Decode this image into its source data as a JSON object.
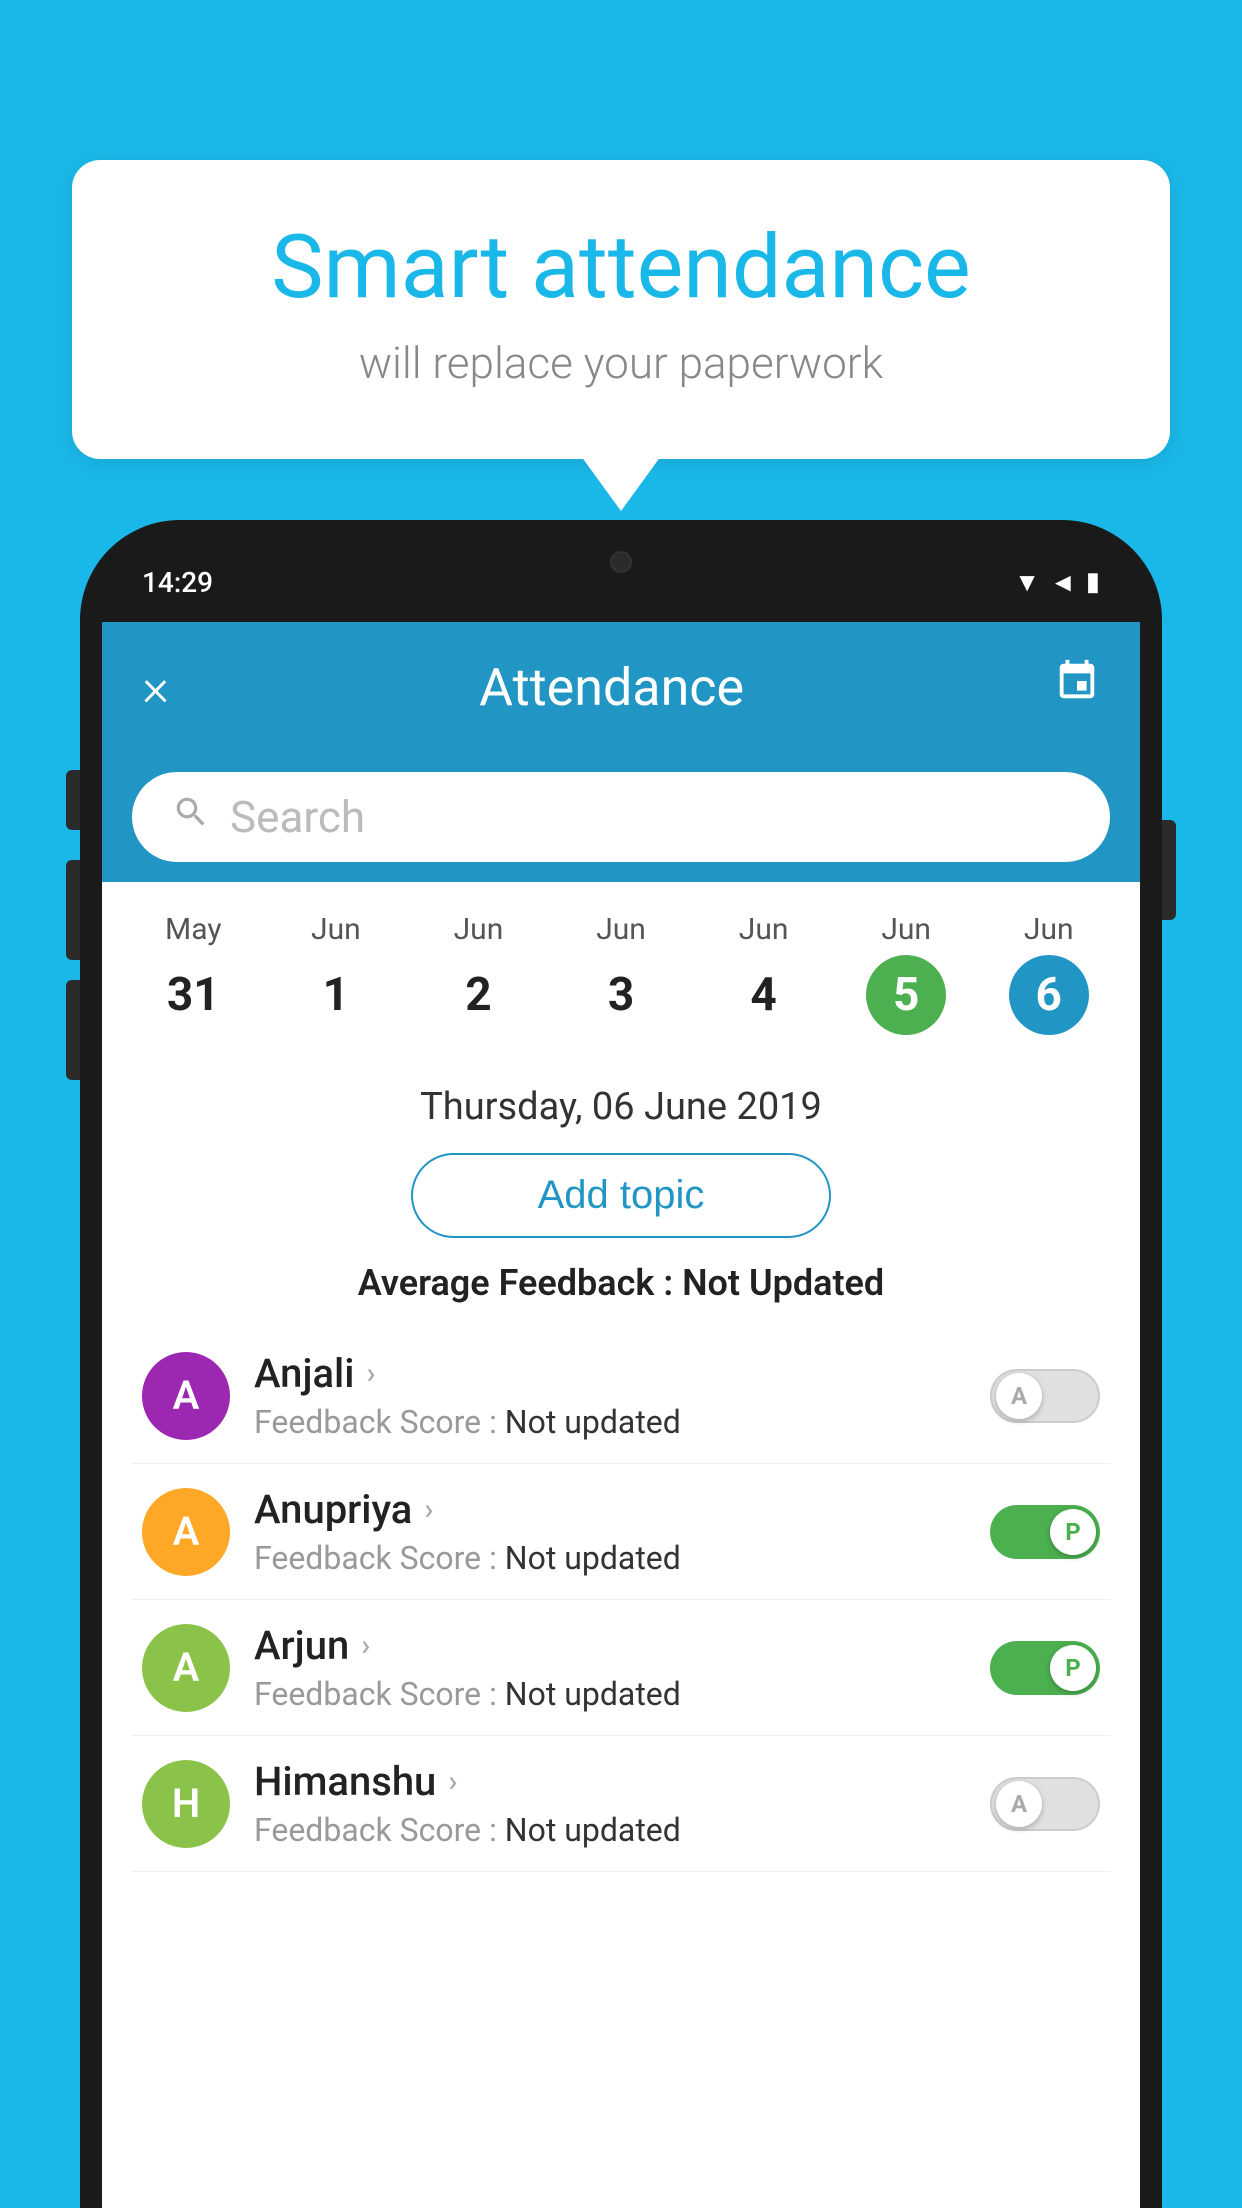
{
  "background_color": "#1ab8e8",
  "bubble": {
    "title": "Smart attendance",
    "subtitle": "will replace your paperwork"
  },
  "status_bar": {
    "time": "14:29",
    "icons": "▼◄▮"
  },
  "header": {
    "close_label": "×",
    "title": "Attendance",
    "calendar_icon": "📅"
  },
  "search": {
    "placeholder": "Search"
  },
  "calendar": {
    "days": [
      {
        "month": "May",
        "num": "31",
        "state": "normal"
      },
      {
        "month": "Jun",
        "num": "1",
        "state": "normal"
      },
      {
        "month": "Jun",
        "num": "2",
        "state": "normal"
      },
      {
        "month": "Jun",
        "num": "3",
        "state": "normal"
      },
      {
        "month": "Jun",
        "num": "4",
        "state": "normal"
      },
      {
        "month": "Jun",
        "num": "5",
        "state": "today"
      },
      {
        "month": "Jun",
        "num": "6",
        "state": "selected"
      }
    ]
  },
  "selected_date": "Thursday, 06 June 2019",
  "add_topic_label": "Add topic",
  "avg_feedback_label": "Average Feedback :",
  "avg_feedback_value": "Not Updated",
  "students": [
    {
      "name": "Anjali",
      "avatar_letter": "A",
      "avatar_color": "#9c27b0",
      "feedback_label": "Feedback Score :",
      "feedback_value": "Not updated",
      "toggle": "off",
      "toggle_label": "A"
    },
    {
      "name": "Anupriya",
      "avatar_letter": "A",
      "avatar_color": "#ffa726",
      "feedback_label": "Feedback Score :",
      "feedback_value": "Not updated",
      "toggle": "on",
      "toggle_label": "P"
    },
    {
      "name": "Arjun",
      "avatar_letter": "A",
      "avatar_color": "#8bc34a",
      "feedback_label": "Feedback Score :",
      "feedback_value": "Not updated",
      "toggle": "on",
      "toggle_label": "P"
    },
    {
      "name": "Himanshu",
      "avatar_letter": "H",
      "avatar_color": "#8bc34a",
      "feedback_label": "Feedback Score :",
      "feedback_value": "Not updated",
      "toggle": "off",
      "toggle_label": "A"
    }
  ]
}
